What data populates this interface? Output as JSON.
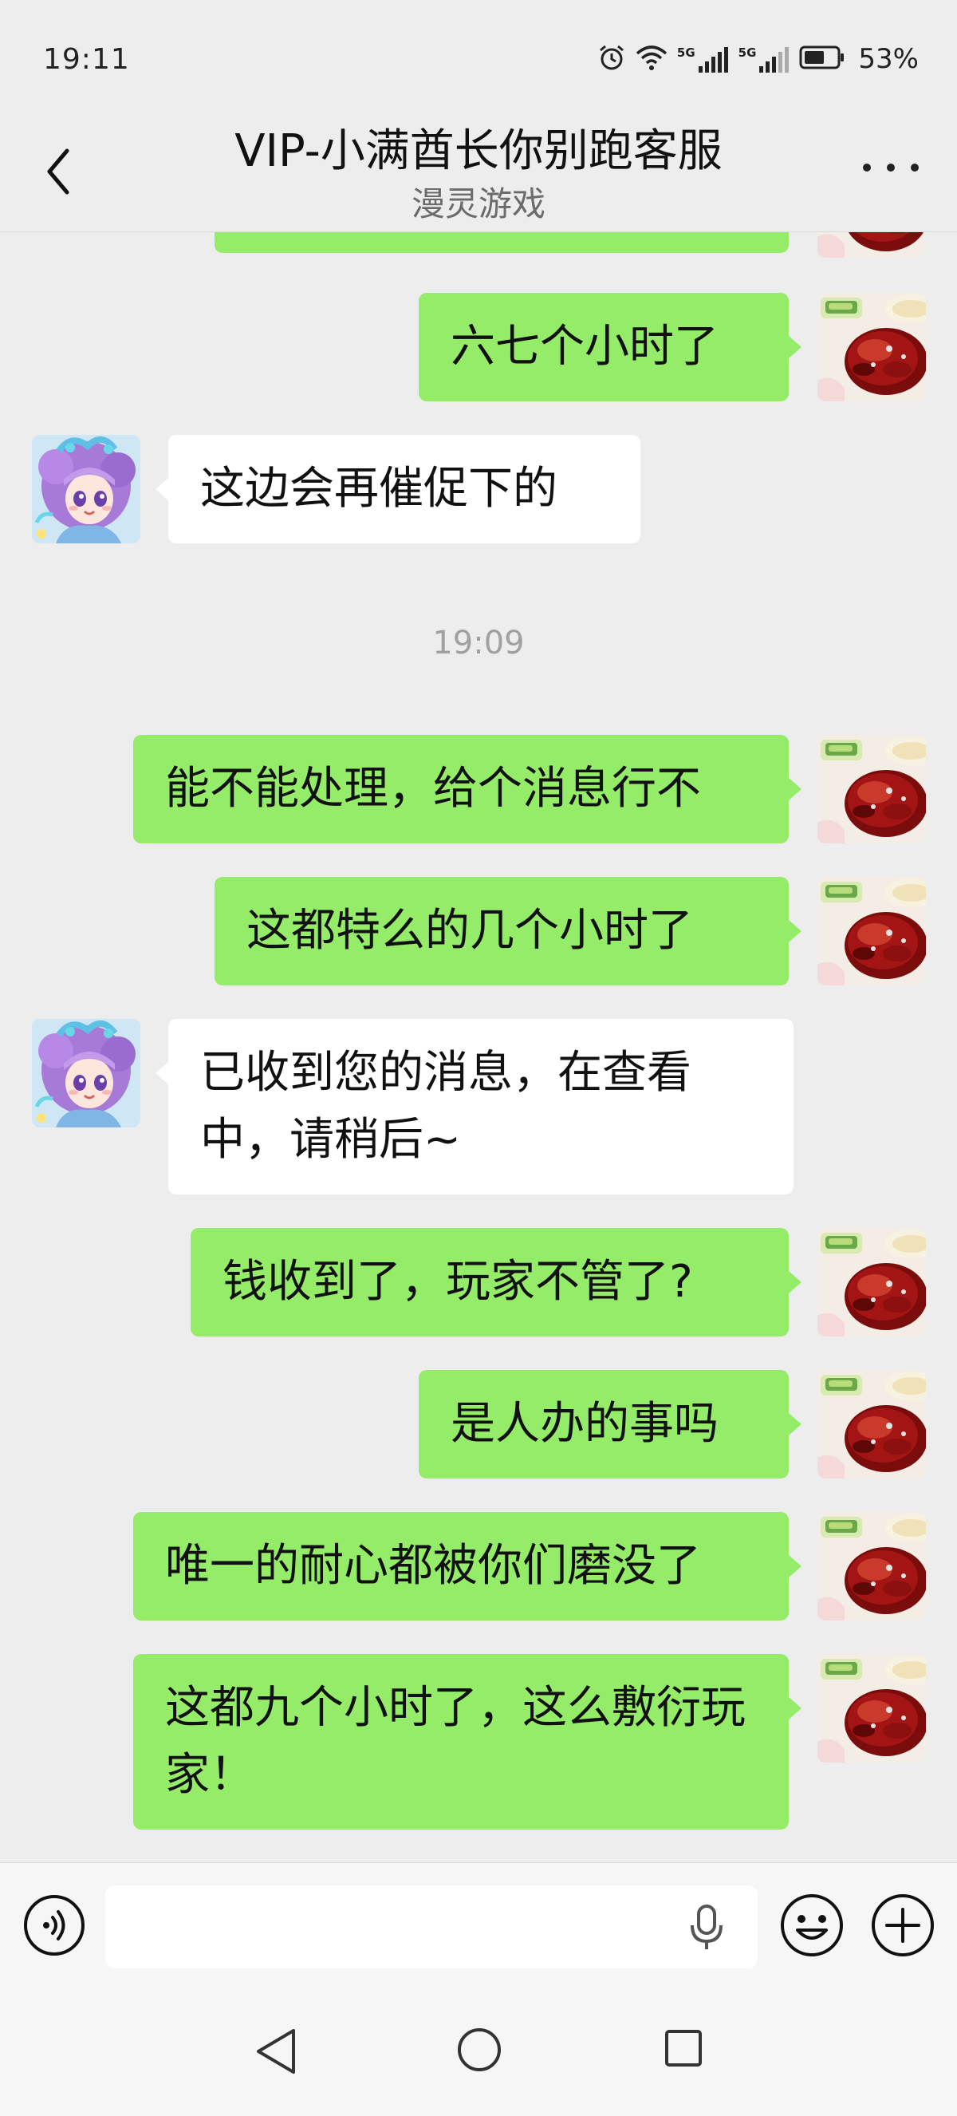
{
  "status_bar": {
    "time": "19:11",
    "battery_percent": "53%",
    "signal_1_label": "5G",
    "signal_2_label": "5G",
    "icons": [
      "alarm-icon",
      "wifi-icon",
      "signal-icon",
      "signal-icon",
      "battery-icon"
    ]
  },
  "header": {
    "title": "VIP-小满酋长你别跑客服",
    "subtitle": "漫灵游戏",
    "back_icon": "chevron-left-icon",
    "more_icon": "more-dots-icon"
  },
  "chat": {
    "timestamp": "19:09",
    "messages": [
      {
        "sender": "me",
        "text": ""
      },
      {
        "sender": "me",
        "text": "六七个小时了"
      },
      {
        "sender": "other",
        "text": "这边会再催促下的"
      },
      {
        "sender": "me",
        "text": "能不能处理，给个消息行不"
      },
      {
        "sender": "me",
        "text": "这都特么的几个小时了"
      },
      {
        "sender": "other",
        "text": "已收到您的消息，在查看中，请稍后~"
      },
      {
        "sender": "me",
        "text": "钱收到了，玩家不管了?"
      },
      {
        "sender": "me",
        "text": "是人办的事吗"
      },
      {
        "sender": "me",
        "text": "唯一的耐心都被你们磨没了"
      },
      {
        "sender": "me",
        "text": "这都九个小时了，这么敷衍玩家！"
      }
    ]
  },
  "input_bar": {
    "voice_icon": "voice-icon",
    "mic_icon": "mic-icon",
    "emoji_icon": "emoji-icon",
    "plus_icon": "plus-icon",
    "text_value": ""
  },
  "nav_bar": {
    "back_icon": "triangle-back-icon",
    "home_icon": "circle-home-icon",
    "recent_icon": "square-recent-icon"
  },
  "colors": {
    "background": "#ededed",
    "my_bubble": "#95ec69",
    "other_bubble": "#ffffff",
    "timestamp": "#a0a0a0"
  }
}
